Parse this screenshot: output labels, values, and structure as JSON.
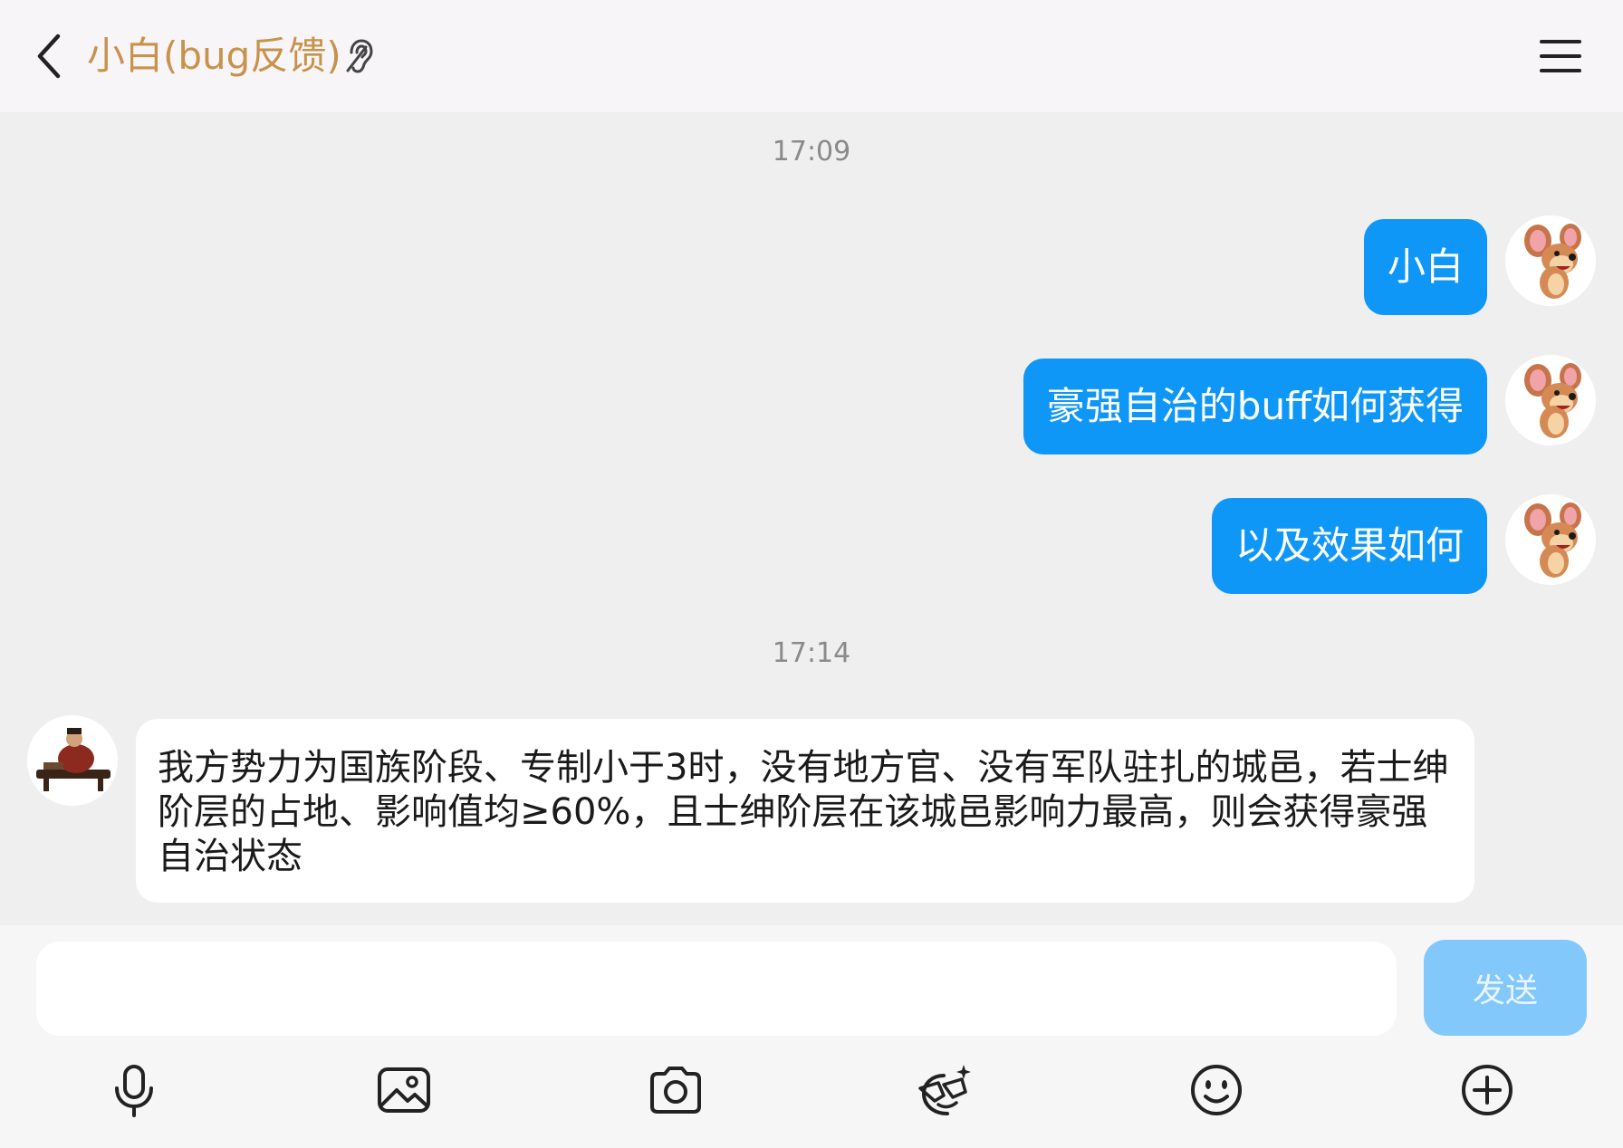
{
  "header": {
    "title": "小白(bug反馈)",
    "back_icon": "chevron-left-icon",
    "listen_icon": "ear-icon",
    "menu_icon": "hamburger-menu-icon"
  },
  "messages": [
    {
      "type": "timestamp",
      "text": "17:09"
    },
    {
      "type": "outgoing",
      "text": "小白"
    },
    {
      "type": "outgoing",
      "text": "豪强自治的buff如何获得"
    },
    {
      "type": "outgoing",
      "text": "以及效果如何"
    },
    {
      "type": "timestamp",
      "text": "17:14"
    },
    {
      "type": "incoming",
      "text": "我方势力为国族阶段、专制小于3时，没有地方官、没有军队驻扎的城邑，若士绅阶层的占地、影响值均≥60%，且士绅阶层在该城邑影响力最高，则会获得豪强自治状态"
    }
  ],
  "composer": {
    "input_value": "",
    "send_label": "发送"
  },
  "toolbar": [
    {
      "icon": "microphone-icon"
    },
    {
      "icon": "image-icon"
    },
    {
      "icon": "camera-icon"
    },
    {
      "icon": "sticker-icon"
    },
    {
      "icon": "emoji-icon"
    },
    {
      "icon": "plus-icon"
    }
  ],
  "colors": {
    "title": "#c8924b",
    "outgoing_bubble": "#0f97f7",
    "send_button_disabled": "#82c8fb"
  }
}
